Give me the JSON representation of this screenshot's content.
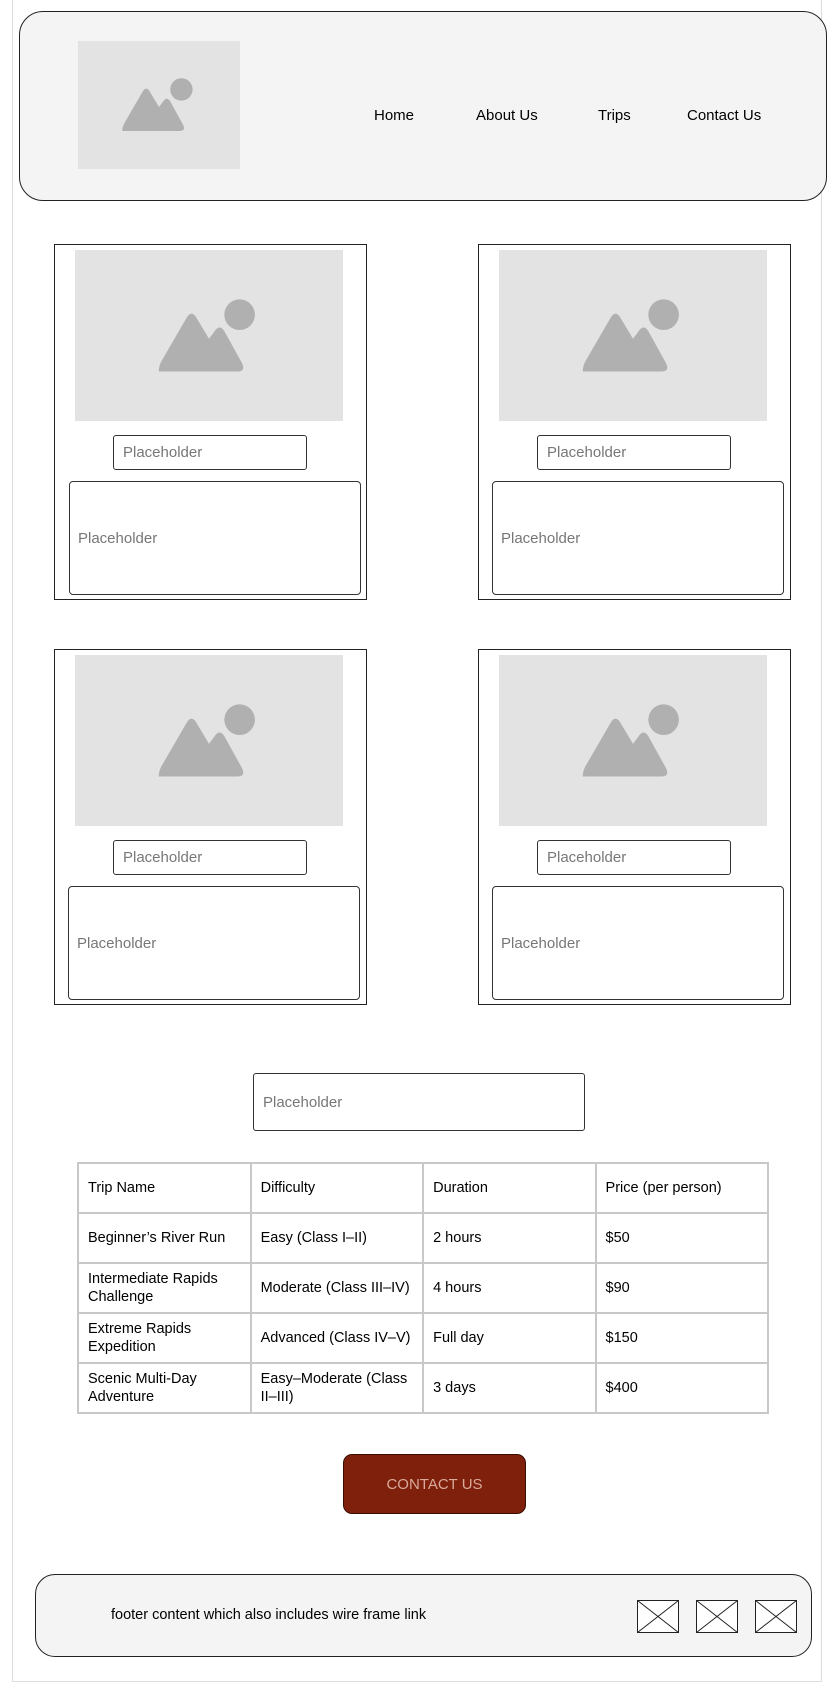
{
  "nav": {
    "logo": "image-placeholder-icon",
    "links": [
      "Home",
      "About Us",
      "Trips",
      "Contact Us"
    ]
  },
  "cards": [
    {
      "title": "Placeholder",
      "body": "Placeholder",
      "image": "image-placeholder-icon"
    },
    {
      "title": "Placeholder",
      "body": "Placeholder",
      "image": "image-placeholder-icon"
    },
    {
      "title": "Placeholder",
      "body": "Placeholder",
      "image": "image-placeholder-icon"
    },
    {
      "title": "Placeholder",
      "body": "Placeholder",
      "image": "image-placeholder-icon"
    }
  ],
  "search": {
    "placeholder": "Placeholder"
  },
  "table": {
    "headers": [
      "Trip Name",
      "Difficulty",
      "Duration",
      "Price (per person)"
    ],
    "rows": [
      [
        "Beginner’s River Run",
        "Easy (Class I–II)",
        "2 hours",
        "$50"
      ],
      [
        "Intermediate Rapids Challenge",
        "Moderate (Class III–IV)",
        "4 hours",
        "$90"
      ],
      [
        "Extreme Rapids Expedition",
        "Advanced (Class IV–V)",
        "Full day",
        "$150"
      ],
      [
        "Scenic Multi-Day Adventure",
        "Easy–Moderate (Class II–III)",
        "3 days",
        "$400"
      ]
    ]
  },
  "cta": {
    "label": "CONTACT US",
    "color": "#7e200c"
  },
  "footer": {
    "text": "footer content which also includes wire frame link",
    "icons": [
      "placeholder-icon",
      "placeholder-icon",
      "placeholder-icon"
    ]
  }
}
